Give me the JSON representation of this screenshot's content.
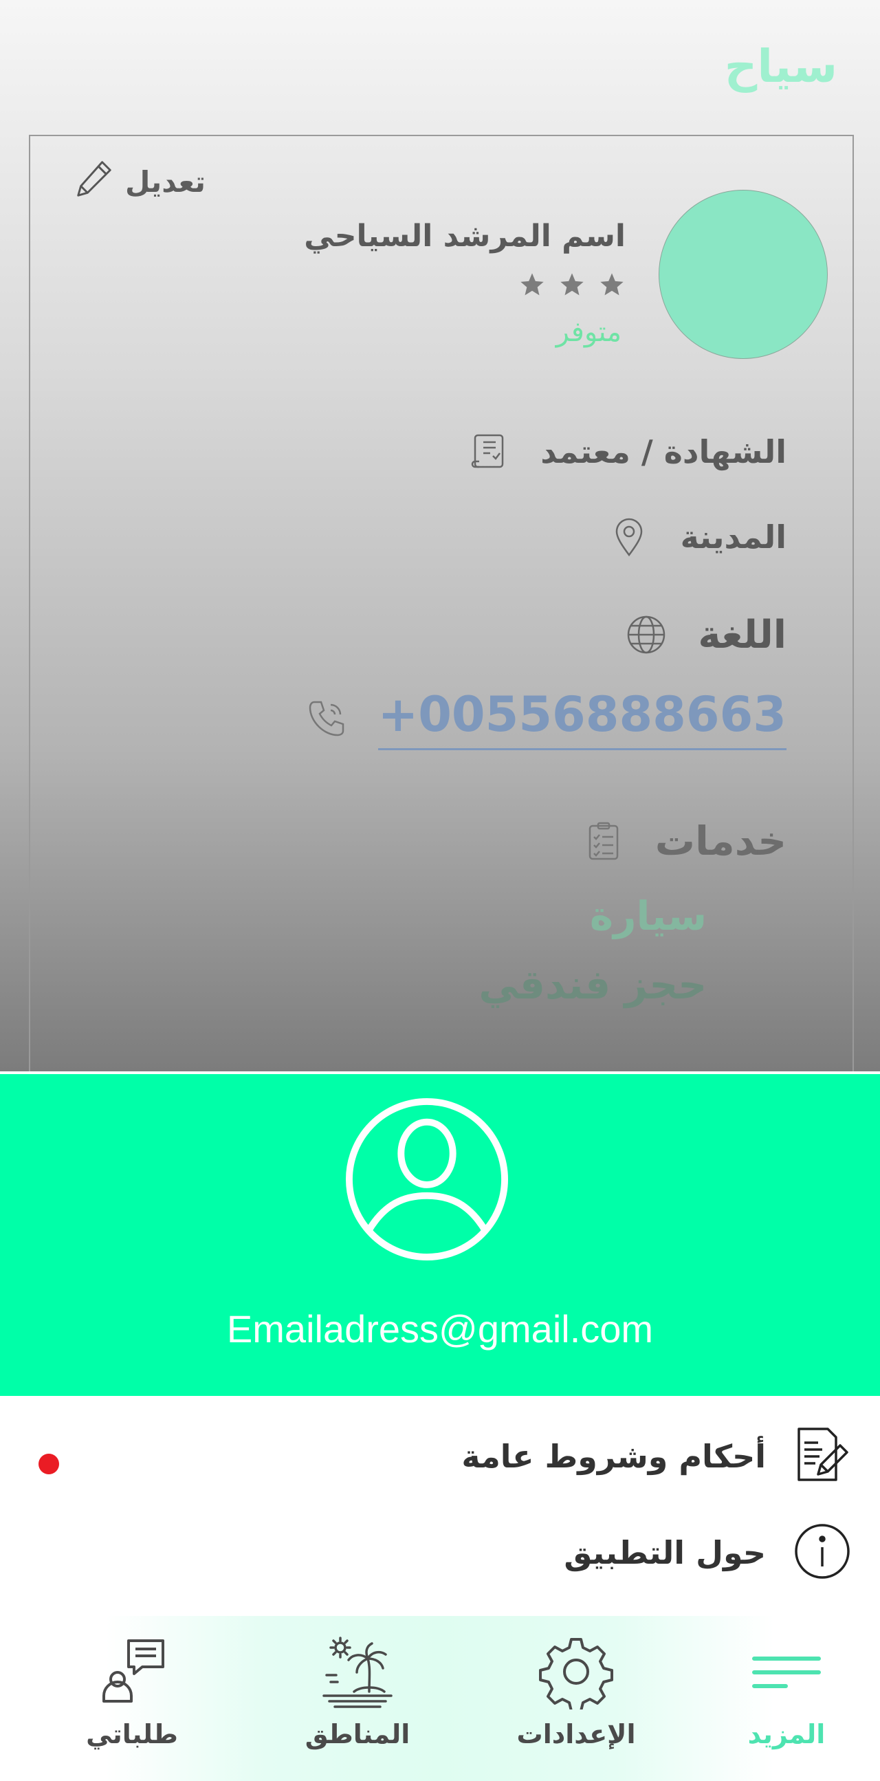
{
  "app": {
    "title": "سياح"
  },
  "profile": {
    "edit_label": "تعديل",
    "name": "اسم المرشد السياحي",
    "rating_stars": 3,
    "availability": "متوفر",
    "certificate": "الشهادة / معتمد",
    "city": "المدينة",
    "language": "اللغة",
    "phone": "+00556888663",
    "services_title": "خدمات",
    "services": [
      "سيارة",
      "حجز فندقي"
    ]
  },
  "drawer": {
    "email": "Emailadress@gmail.com",
    "menu": [
      {
        "label": "أحكام وشروط عامة",
        "icon": "terms-document-icon",
        "notification": true
      },
      {
        "label": "حول التطبيق",
        "icon": "info-icon",
        "notification": false
      }
    ]
  },
  "nav": {
    "items": [
      {
        "label": "طلباتي",
        "icon": "my-requests-icon"
      },
      {
        "label": "المناطق",
        "icon": "regions-icon"
      },
      {
        "label": "الإعدادات",
        "icon": "settings-icon"
      },
      {
        "label": "المزيد",
        "icon": "more-menu-icon",
        "active": true
      }
    ]
  },
  "colors": {
    "accent": "#00ffa8",
    "title_mint": "#9ff0cf",
    "avatar": "#8ae6c4",
    "available_green": "#6fe3a5",
    "phone_blue": "#7e98bc",
    "notification_red": "#ea1c24"
  }
}
